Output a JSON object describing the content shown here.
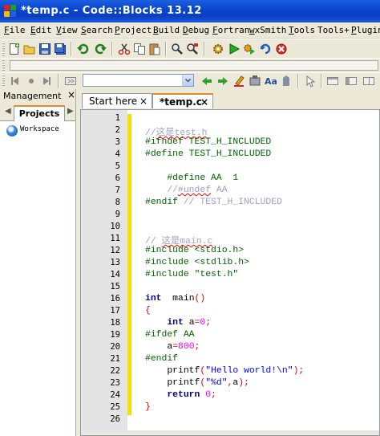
{
  "window": {
    "title": "*temp.c - Code::Blocks 13.12"
  },
  "menu": [
    {
      "label": "File",
      "u": "F",
      "rest": "ile"
    },
    {
      "label": "Edit",
      "u": "E",
      "rest": "dit"
    },
    {
      "label": "View",
      "u": "V",
      "rest": "iew"
    },
    {
      "label": "Search",
      "u": "S",
      "rest": "earch"
    },
    {
      "label": "Project",
      "u": "P",
      "rest": "roject"
    },
    {
      "label": "Build",
      "u": "B",
      "rest": "uild"
    },
    {
      "label": "Debug",
      "u": "D",
      "rest": "ebug"
    },
    {
      "label": "Fortran",
      "u": "F",
      "rest": "ortran"
    },
    {
      "label": "wxSmith",
      "u": "w",
      "rest": "xSmith"
    },
    {
      "label": "Tools",
      "u": "T",
      "rest": "ools"
    },
    {
      "label": "Tools+",
      "u": "",
      "rest": "Tools+"
    },
    {
      "label": "Plugins",
      "u": "P",
      "rest": "lugins"
    }
  ],
  "management": {
    "title": "Management",
    "close": "×",
    "tab": "Projects",
    "workspace": "Workspace"
  },
  "tabs": [
    {
      "label": "Start here",
      "close": "×"
    },
    {
      "label": "*temp.c",
      "close": "×"
    }
  ],
  "colors": {
    "titlebar": "#0a46d0",
    "change_bar": "#f5e000",
    "active_tab_accent": "#e68b2c",
    "keyword": "#00008b",
    "preprocessor": "#006400",
    "comment": "#a0a0c8",
    "number": "#f000f0",
    "string": "#0000ff",
    "operator": "#e00000"
  },
  "code": {
    "line_numbers": [
      "1",
      "2",
      "3",
      "4",
      "5",
      "6",
      "7",
      "8",
      "9",
      "10",
      "11",
      "12",
      "13",
      "14",
      "15",
      "16",
      "17",
      "18",
      "19",
      "20",
      "21",
      "22",
      "23",
      "24",
      "25",
      "26"
    ],
    "lines": [
      [],
      [
        [
          "cm",
          "//"
        ],
        [
          "cm sq",
          "这是test.h"
        ]
      ],
      [
        [
          "pp",
          "#ifndef TEST_H_INCLUDED"
        ]
      ],
      [
        [
          "pp",
          "#define TEST_H_INCLUDED"
        ]
      ],
      [],
      [
        [
          "pp",
          "    #define AA  1"
        ]
      ],
      [
        [
          "cm",
          "    //"
        ],
        [
          "cm sq",
          "#undef"
        ],
        [
          "cm",
          " AA"
        ]
      ],
      [
        [
          "pp",
          "#endif "
        ],
        [
          "cm",
          "// TEST_H_INCLUDED"
        ]
      ],
      [],
      [],
      [
        [
          "cm",
          "// "
        ],
        [
          "cm sq",
          "这是main.c"
        ]
      ],
      [
        [
          "pp",
          "#include <stdio.h>"
        ]
      ],
      [
        [
          "pp",
          "#include <stdlib.h>"
        ]
      ],
      [
        [
          "pp",
          "#include \"test.h\""
        ]
      ],
      [],
      [
        [
          "kw",
          "int"
        ],
        [
          "",
          "  main"
        ],
        [
          "op",
          "()"
        ]
      ],
      [
        [
          "op",
          "{"
        ]
      ],
      [
        [
          "kw",
          "    int"
        ],
        [
          "",
          " a"
        ],
        [
          "op",
          "="
        ],
        [
          "num",
          "0"
        ],
        [
          "op",
          ";"
        ]
      ],
      [
        [
          "pp",
          "#ifdef AA"
        ]
      ],
      [
        [
          "",
          "    a"
        ],
        [
          "op",
          "="
        ],
        [
          "num",
          "800"
        ],
        [
          "op",
          ";"
        ]
      ],
      [
        [
          "pp",
          "#endif"
        ]
      ],
      [
        [
          "",
          "    printf"
        ],
        [
          "op",
          "("
        ],
        [
          "str",
          "\"Hello world!\\n\""
        ],
        [
          "op",
          ");"
        ]
      ],
      [
        [
          "",
          "    printf"
        ],
        [
          "op",
          "("
        ],
        [
          "str",
          "\"%d\""
        ],
        [
          "op",
          ","
        ],
        [
          "",
          "a"
        ],
        [
          "op",
          ");"
        ]
      ],
      [
        [
          "kw",
          "    return"
        ],
        [
          "",
          " "
        ],
        [
          "num",
          "0"
        ],
        [
          "op",
          ";"
        ]
      ],
      [
        [
          "op",
          "}"
        ]
      ],
      []
    ]
  }
}
